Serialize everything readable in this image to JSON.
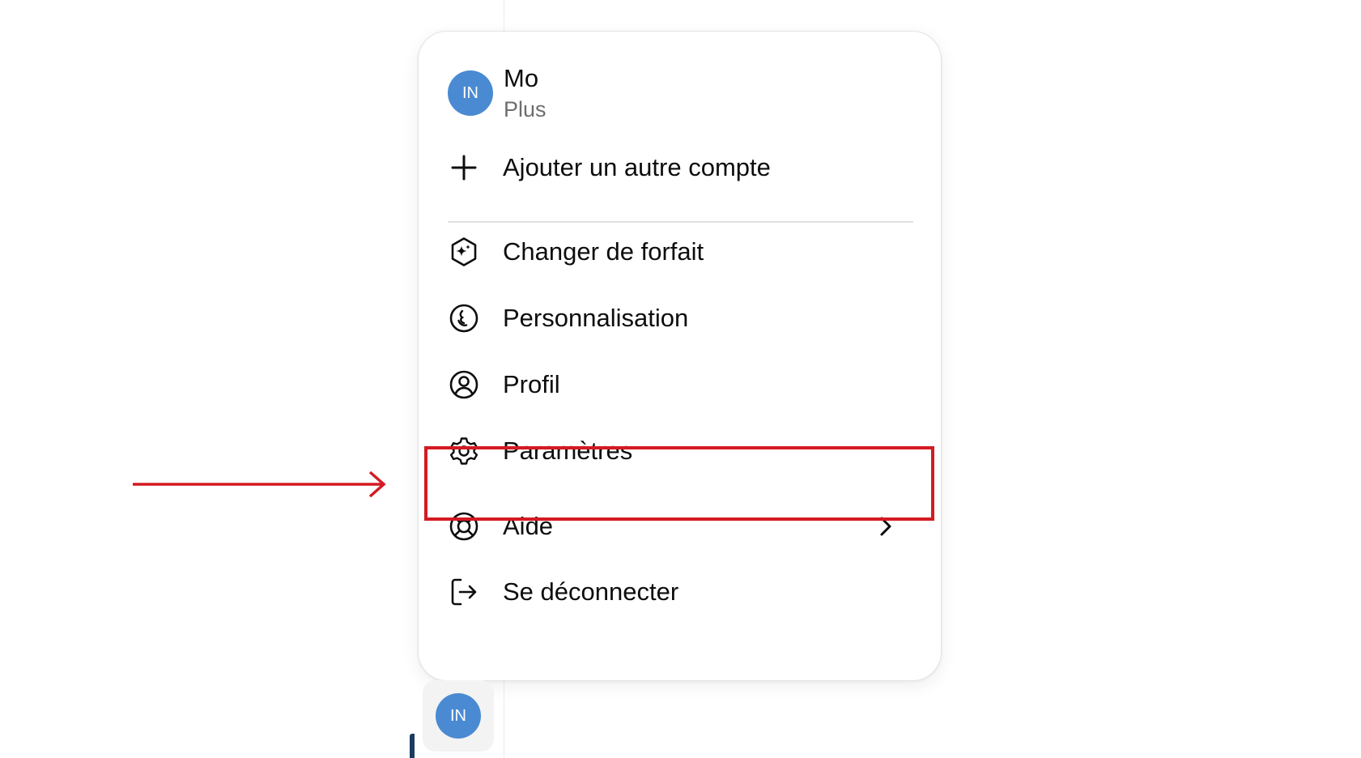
{
  "account": {
    "initials": "IN",
    "name": "Mo",
    "plan": "Plus"
  },
  "menu": {
    "items": [
      {
        "label": "Ajouter un autre compte",
        "icon": "plus-icon"
      },
      {
        "label": "Changer de forfait",
        "icon": "sparkle-badge-icon"
      },
      {
        "label": "Personnalisation",
        "icon": "smiley-icon"
      },
      {
        "label": "Profil",
        "icon": "user-circle-icon"
      },
      {
        "label": "Paramètres",
        "icon": "gear-icon"
      },
      {
        "label": "Aide",
        "icon": "lifebuoy-icon",
        "submenu_icon": "chevron-right-icon"
      },
      {
        "label": "Se déconnecter",
        "icon": "logout-icon"
      }
    ]
  },
  "bottom_avatar": {
    "initials": "IN"
  },
  "annotation": {
    "highlighted_item": "Paramètres",
    "color": "#d41a22"
  },
  "colors": {
    "avatar": "#4a8ad2",
    "text": "#0d0d0d",
    "secondary_text": "#6e6e6e",
    "highlight": "#d41a22"
  }
}
